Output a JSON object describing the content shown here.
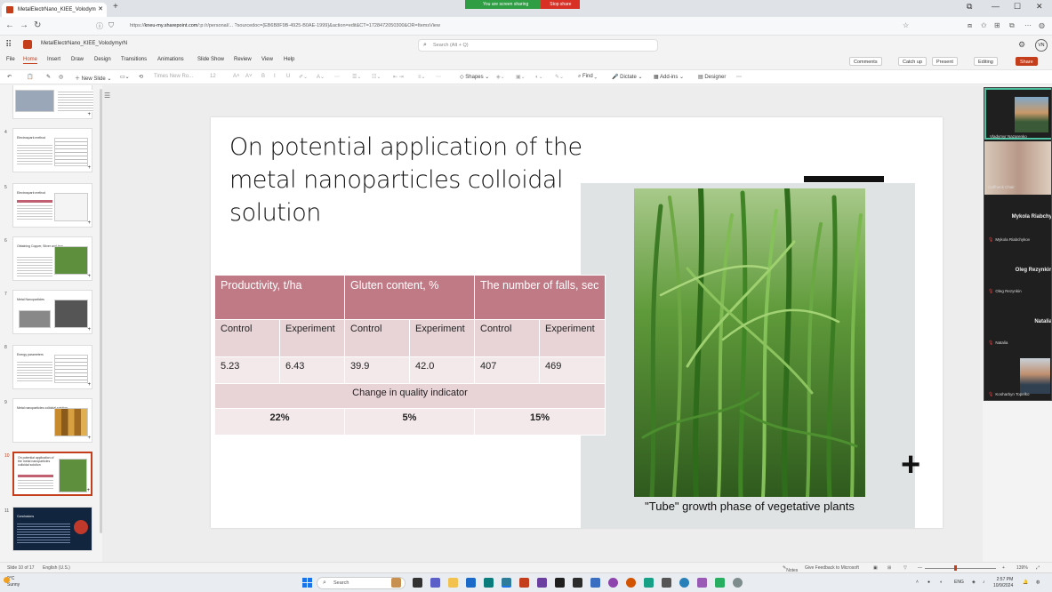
{
  "browser": {
    "tab_title": "MetalElectrNano_KIEE_Volodym",
    "tab_close": "✕",
    "new_tab": "+",
    "url_prefix": "https://",
    "url_host": "kneu-my.sharepoint.com",
    "url_rest": "/:p:/r/personal/... ?sourcedoc={EB6B8F9B-4925-B0AE-1999}&action=edit&CT=1728472050300&OR=ItemsView",
    "sharing_text": "You are screen sharing",
    "stop_share": "Stop share"
  },
  "office": {
    "doc_name": "MetalElectrNano_KIEE_VolodymyrN",
    "search_placeholder": "Search (Alt + Q)",
    "user_initials": "VN",
    "menu": [
      "File",
      "Home",
      "Insert",
      "Draw",
      "Design",
      "Transitions",
      "Animations",
      "Slide Show",
      "Review",
      "View",
      "Help"
    ],
    "active_menu": "Home",
    "right_buttons": {
      "comments": "Comments",
      "catch_up": "Catch up",
      "present": "Present",
      "editing": "Editing",
      "share": "Share"
    },
    "ribbon": {
      "new_slide": "New Slide",
      "font": "Times New Ro...",
      "font_size": "12",
      "shapes": "Shapes",
      "find": "Find",
      "dictate": "Dictate",
      "addins": "Add-ins",
      "designer": "Designer"
    }
  },
  "thumbnails": [
    {
      "num": "",
      "title": ""
    },
    {
      "num": "4",
      "title": "Electrospark method"
    },
    {
      "num": "5",
      "title": "Electrospark method"
    },
    {
      "num": "6",
      "title": "Obtaining Copper, Silver and Iron"
    },
    {
      "num": "7",
      "title": "Metal Nanoparticles"
    },
    {
      "num": "8",
      "title": "Energy parameters"
    },
    {
      "num": "9",
      "title": "Metal nanoparticles colloidal solution"
    },
    {
      "num": "10",
      "title": "On potential application of the metal nanoparticles colloidal solution"
    },
    {
      "num": "11",
      "title": "Conclusions"
    }
  ],
  "slide": {
    "title": "On potential application of the metal nanoparticles colloidal solution",
    "caption": "\"Tube\" growth phase of vegetative plants",
    "plus": "+",
    "table": {
      "headers": [
        "Productivity, t/ha",
        "Gluten content, %",
        "The number of falls, sec"
      ],
      "subheaders": [
        "Control",
        "Experiment",
        "Control",
        "Experiment",
        "Control",
        "Experiment"
      ],
      "values": [
        "5.23",
        "6.43",
        "39.9",
        "42.0",
        "407",
        "469"
      ],
      "change_label": "Change in quality indicator",
      "changes": [
        "22%",
        "5%",
        "15%"
      ]
    }
  },
  "participants": [
    {
      "name": "Vladymyr Nazarenko",
      "big": ""
    },
    {
      "name": "Gaffneck Chair",
      "big": ""
    },
    {
      "name": "Mykola Riabchykov",
      "big": "Mykola Riabchy"
    },
    {
      "name": "Oleg Rezynkin",
      "big": "Oleg Rezynkin"
    },
    {
      "name": "Natalia",
      "big": "Natalia"
    },
    {
      "name": "Kosharbyn Topelko",
      "big": ""
    }
  ],
  "status": {
    "slide_info": "Slide 10 of 17",
    "language": "English (U.S.)",
    "notes": "Notes",
    "feedback": "Give Feedback to Microsoft",
    "zoom": "139%"
  },
  "taskbar": {
    "temp": "9°C",
    "weather": "Sunny",
    "search": "Search",
    "lang": "ENG",
    "time": "2:57 PM",
    "date": "10/9/2024"
  }
}
